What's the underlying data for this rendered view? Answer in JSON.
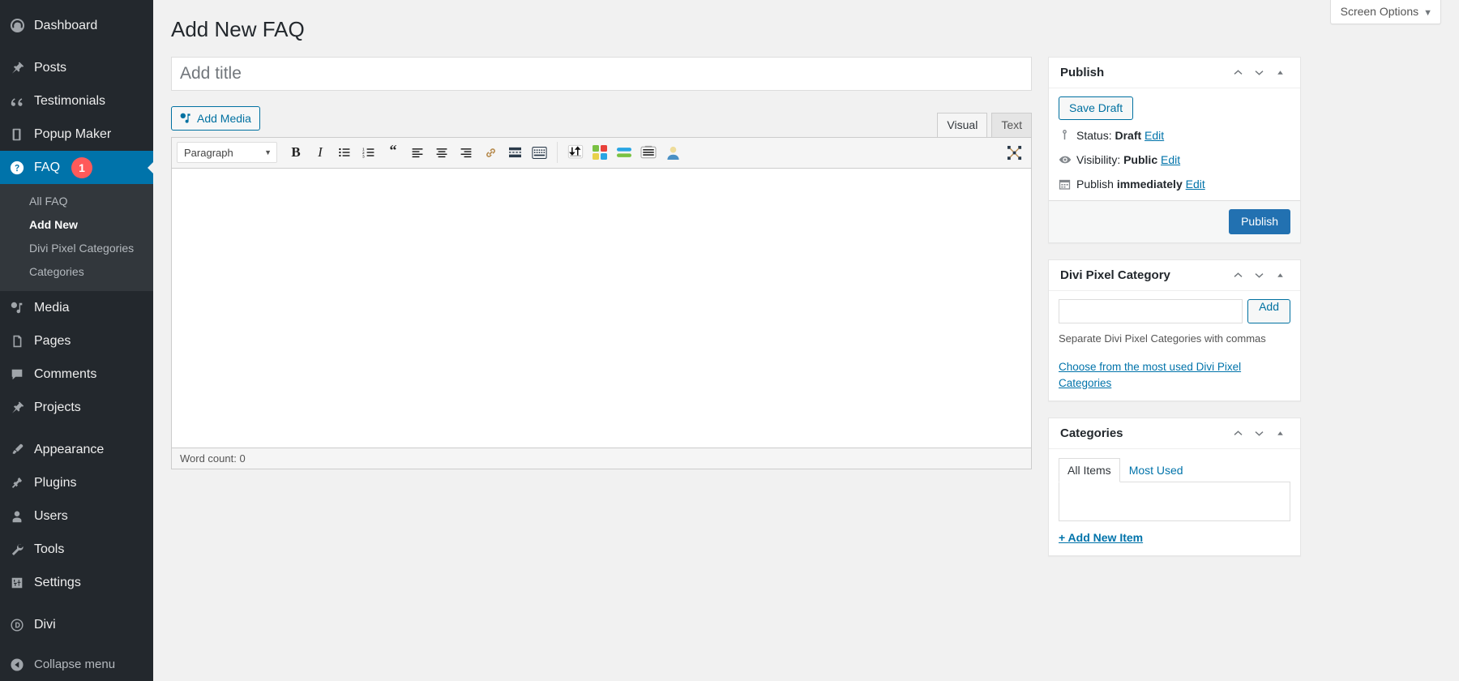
{
  "sidebar": {
    "items": [
      {
        "label": "Dashboard",
        "icon": "dashboard-icon",
        "state": "normal"
      },
      {
        "label": "Posts",
        "icon": "pin-icon",
        "state": "normal"
      },
      {
        "label": "Testimonials",
        "icon": "quote-icon",
        "state": "normal"
      },
      {
        "label": "Popup Maker",
        "icon": "book-icon",
        "state": "normal"
      },
      {
        "label": "FAQ",
        "icon": "question-icon",
        "state": "active",
        "badge": "1"
      },
      {
        "label": "Media",
        "icon": "media-icon",
        "state": "normal"
      },
      {
        "label": "Pages",
        "icon": "page-icon",
        "state": "normal"
      },
      {
        "label": "Comments",
        "icon": "comment-icon",
        "state": "normal"
      },
      {
        "label": "Projects",
        "icon": "pin-icon",
        "state": "normal"
      },
      {
        "label": "Appearance",
        "icon": "brush-icon",
        "state": "normal"
      },
      {
        "label": "Plugins",
        "icon": "plug-icon",
        "state": "normal"
      },
      {
        "label": "Users",
        "icon": "user-icon",
        "state": "normal"
      },
      {
        "label": "Tools",
        "icon": "wrench-icon",
        "state": "normal"
      },
      {
        "label": "Settings",
        "icon": "settings-icon",
        "state": "normal"
      },
      {
        "label": "Divi",
        "icon": "divi-icon",
        "state": "normal"
      }
    ],
    "submenu": [
      {
        "label": "All FAQ",
        "current": false
      },
      {
        "label": "Add New",
        "current": true
      },
      {
        "label": "Divi Pixel Categories",
        "current": false
      },
      {
        "label": "Categories",
        "current": false
      }
    ],
    "collapse": {
      "label": "Collapse menu",
      "icon": "collapse-icon"
    },
    "colors": {
      "background": "#23282d",
      "submenu_background": "#32373c",
      "active": "#0073aa",
      "badge": "#ff5a5a"
    }
  },
  "header": {
    "screen_options": "Screen Options",
    "screen_options_caret": "▼",
    "page_title": "Add New FAQ"
  },
  "editor": {
    "title_placeholder": "Add title",
    "title_value": "",
    "add_media_label": "Add Media",
    "tabs": [
      {
        "label": "Visual",
        "active": true
      },
      {
        "label": "Text",
        "active": false
      }
    ],
    "format_select": "Paragraph",
    "format_caret": "▼",
    "toolbar_buttons": [
      "bold-icon",
      "italic-icon",
      "bulleted-list-icon",
      "numbered-list-icon",
      "blockquote-icon",
      "align-left-icon",
      "align-center-icon",
      "align-right-icon",
      "link-icon",
      "read-more-icon",
      "keyboard-shortcuts-icon"
    ],
    "toolbar_buttons_2": [
      "sort-order-icon",
      "divi-pixel-modules-icon",
      "divi-builder-icon",
      "toggle-rows-icon",
      "user-avatar-icon"
    ],
    "fullscreen_icon": "fullscreen-icon",
    "word_count_label": "Word count: 0"
  },
  "publish_box": {
    "title": "Publish",
    "controls": {
      "up": "chevron-up-icon",
      "down": "chevron-down-icon",
      "toggle": "toggle-icon"
    },
    "save_draft_label": "Save Draft",
    "status": {
      "icon": "pin-status-icon",
      "label": "Status:",
      "value": "Draft",
      "edit": "Edit"
    },
    "visibility": {
      "icon": "eye-icon",
      "label": "Visibility:",
      "value": "Public",
      "edit": "Edit"
    },
    "schedule": {
      "icon": "calendar-icon",
      "label": "Publish",
      "value": "immediately",
      "edit": "Edit"
    },
    "publish_label": "Publish",
    "accent_color": "#2271b1"
  },
  "divi_pixel_category_box": {
    "title": "Divi Pixel Category",
    "input_value": "",
    "add_label": "Add",
    "help_text": "Separate Divi Pixel Categories with commas",
    "cloud_link": "Choose from the most used Divi Pixel Categories"
  },
  "categories_box": {
    "title": "Categories",
    "tabs": [
      {
        "label": "All Items",
        "active": true
      },
      {
        "label": "Most Used",
        "active": false
      }
    ],
    "items": [],
    "add_new_label": "+ Add New Item"
  }
}
